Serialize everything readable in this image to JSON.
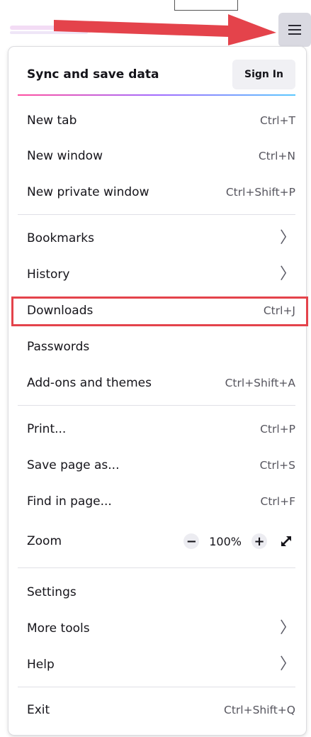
{
  "sync": {
    "label": "Sync and save data",
    "signin_label": "Sign In"
  },
  "items": [
    {
      "label": "New tab",
      "shortcut": "Ctrl+T"
    },
    {
      "label": "New window",
      "shortcut": "Ctrl+N"
    },
    {
      "label": "New private window",
      "shortcut": "Ctrl+Shift+P"
    },
    {
      "label": "Bookmarks"
    },
    {
      "label": "History"
    },
    {
      "label": "Downloads",
      "shortcut": "Ctrl+J"
    },
    {
      "label": "Passwords"
    },
    {
      "label": "Add-ons and themes",
      "shortcut": "Ctrl+Shift+A"
    },
    {
      "label": "Print...",
      "shortcut": "Ctrl+P"
    },
    {
      "label": "Save page as...",
      "shortcut": "Ctrl+S"
    },
    {
      "label": "Find in page...",
      "shortcut": "Ctrl+F"
    },
    {
      "label": "Zoom"
    },
    {
      "label": "Settings"
    },
    {
      "label": "More tools"
    },
    {
      "label": "Help"
    },
    {
      "label": "Exit",
      "shortcut": "Ctrl+Shift+Q"
    }
  ],
  "zoom": {
    "minus": "−",
    "value": "100%",
    "plus": "+"
  },
  "submenu_glyph": "〉",
  "icons": {
    "menu": "hamburger-menu-icon",
    "fullscreen": "fullscreen-icon",
    "chevron": "chevron-right-icon"
  },
  "colors": {
    "annotation": "#e4434b",
    "menu_button_bg": "#d9d9e1"
  }
}
